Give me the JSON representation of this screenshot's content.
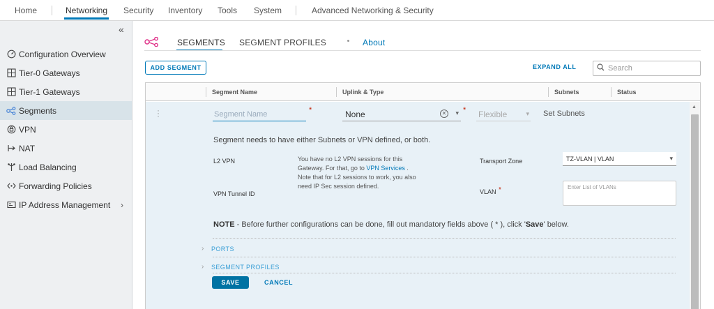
{
  "topnav": {
    "items": [
      "Home",
      "Networking",
      "Security",
      "Inventory",
      "Tools",
      "System",
      "Advanced Networking & Security"
    ],
    "active": "Networking"
  },
  "sidebar": {
    "collapse_icon": "«",
    "items": [
      {
        "label": "Configuration Overview",
        "icon": "dashboard-icon"
      },
      {
        "label": "Tier-0 Gateways",
        "icon": "gateway-icon"
      },
      {
        "label": "Tier-1 Gateways",
        "icon": "gateway-icon"
      },
      {
        "label": "Segments",
        "icon": "segments-icon",
        "active": true
      },
      {
        "label": "VPN",
        "icon": "vpn-icon"
      },
      {
        "label": "NAT",
        "icon": "nat-icon"
      },
      {
        "label": "Load Balancing",
        "icon": "load-balancer-icon"
      },
      {
        "label": "Forwarding Policies",
        "icon": "forwarding-icon"
      },
      {
        "label": "IP Address Management",
        "icon": "ipam-icon",
        "has_children": true
      }
    ]
  },
  "main": {
    "tabs": [
      "SEGMENTS",
      "SEGMENT PROFILES",
      "About"
    ],
    "active_tab": "SEGMENTS",
    "add_segment": "ADD SEGMENT",
    "expand_all": "EXPAND ALL",
    "search_placeholder": "Search",
    "columns": [
      "Segment Name",
      "Uplink & Type",
      "Subnets",
      "Status"
    ],
    "row": {
      "segment_name_placeholder": "Segment Name",
      "uplink_value": "None",
      "type_value": "Flexible",
      "set_subnets": "Set Subnets",
      "message": "Segment needs to have either Subnets or VPN defined, or both.",
      "l2vpn_label": "L2 VPN",
      "vpn_tunnel_label": "VPN Tunnel ID",
      "desc_part1": "You have no L2 VPN sessions for this Gateway. For that, go to ",
      "desc_link": "VPN Services",
      "desc_part2": " . Note that for L2 sessions to work, you also need IP Sec session defined.",
      "transport_zone_label": "Transport Zone",
      "transport_zone_value": "TZ-VLAN | VLAN",
      "vlan_label": "VLAN",
      "vlan_placeholder": "Enter List of VLANs",
      "note_prefix": "NOTE",
      "note_text": " - Before further configurations can be done, fill out mandatory fields above ( * ), click '",
      "note_save": "Save",
      "note_suffix": "' below.",
      "ports_label": "PORTS",
      "segment_profiles_label": "SEGMENT PROFILES",
      "save": "SAVE",
      "cancel": "CANCEL"
    }
  },
  "colors": {
    "accent": "#0079b8",
    "sidebar_bg": "#eef0f2",
    "row_bg": "#e8f1f7",
    "required": "#c21d00",
    "segments_icon": "#e0348a"
  }
}
